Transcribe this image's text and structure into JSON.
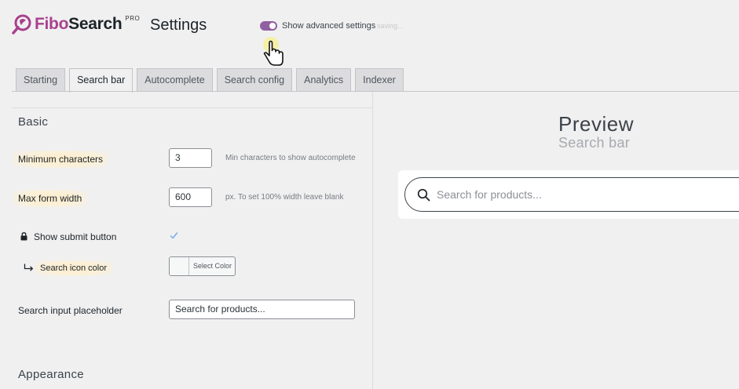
{
  "header": {
    "logo_text_fibo": "Fibo",
    "logo_text_search": "Search",
    "logo_pro": "PRO",
    "title": "Settings",
    "advanced_toggle_label": "Show advanced settings",
    "advanced_toggle_on": true,
    "saving_text": "saving..."
  },
  "tabs": [
    {
      "label": "Starting",
      "active": false
    },
    {
      "label": "Search bar",
      "active": true
    },
    {
      "label": "Autocomplete",
      "active": false
    },
    {
      "label": "Search config",
      "active": false
    },
    {
      "label": "Analytics",
      "active": false
    },
    {
      "label": "Indexer",
      "active": false
    }
  ],
  "basic": {
    "section_title": "Basic",
    "min_chars": {
      "label": "Minimum characters",
      "value": "3",
      "hint": "Min characters to show autocomplete"
    },
    "max_width": {
      "label": "Max form width",
      "value": "600",
      "hint": "px. To set 100% width leave blank"
    },
    "submit_button": {
      "label": "Show submit button",
      "checked": true
    },
    "icon_color": {
      "label": "Search icon color",
      "button_label": "Select Color"
    },
    "placeholder": {
      "label": "Search input placeholder",
      "value": "Search for products..."
    }
  },
  "appearance": {
    "section_title": "Appearance"
  },
  "preview": {
    "title": "Preview",
    "subtitle": "Search bar",
    "placeholder": "Search for products..."
  },
  "colors": {
    "brand": "#a8418d",
    "toggle": "#9160a0",
    "highlight": "#fbeccc"
  },
  "icons": [
    "fibosearch-logo-icon",
    "hand-pointer-cursor-icon",
    "lock-icon",
    "check-icon",
    "subdirectory-arrow-icon",
    "search-icon"
  ]
}
